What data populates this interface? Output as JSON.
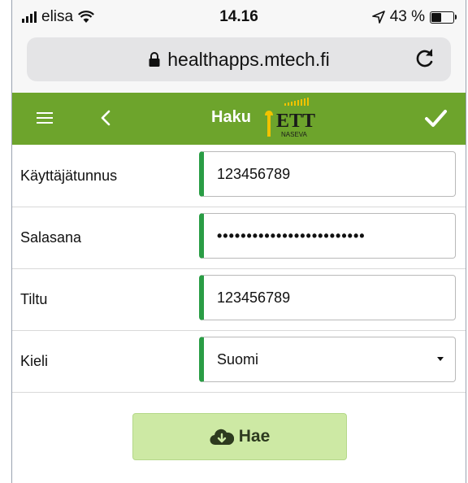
{
  "status_bar": {
    "carrier": "elisa",
    "time": "14.16",
    "battery_text": "43 %",
    "battery_level": 0.43
  },
  "browser": {
    "url": "healthapps.mtech.fi",
    "icons": [
      "lock-icon",
      "reload-icon"
    ]
  },
  "header": {
    "title": "Haku",
    "logo_text": "ETT",
    "logo_subtext": "NASEVA",
    "icons": [
      "menu-icon",
      "back-icon",
      "check-icon"
    ],
    "color": "#6da42c"
  },
  "form": {
    "username_label": "Käyttäjätunnus",
    "username_value": "123456789",
    "password_label": "Salasana",
    "password_value": "•••••••••••••••••••••••••",
    "tiltu_label": "Tiltu",
    "tiltu_value": "123456789",
    "language_label": "Kieli",
    "language_value": "Suomi",
    "accent_color": "#2a9d45"
  },
  "search_button": {
    "label": "Hae",
    "icon": "cloud-download-icon",
    "color": "#cde9a4"
  }
}
